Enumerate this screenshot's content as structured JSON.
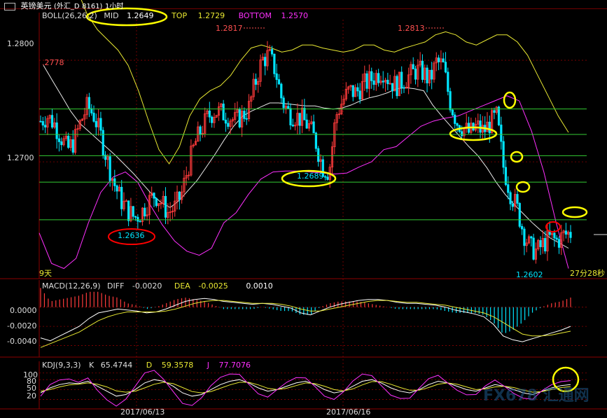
{
  "title_bar": {
    "symbol": "英镑美元",
    "market": "(外汇_D",
    "code": "8161)",
    "period": "1小时"
  },
  "colors": {
    "background": "#000000",
    "up": "#ff3b3b",
    "down": "#00e5ff",
    "mid": "#e8e8e8",
    "top": "#e8e832",
    "bottom": "#ff30ff",
    "grid": "#8b0000",
    "hline": "#33cc33",
    "highlight_yellow": "#ffff00",
    "highlight_red": "#ff0000"
  },
  "boll": {
    "label": "BOLL(26,26,2)",
    "mid_label": "MID",
    "mid_value": "1.2649",
    "top_label": "TOP",
    "top_value": "1.2729",
    "bottom_label": "BOTTOM",
    "bottom_value": "1.2570"
  },
  "macd": {
    "label": "MACD(12,26,9)",
    "diff_label": "DIFF",
    "diff_value": "-0.0020",
    "dea_label": "DEA",
    "dea_value": "-0.0025",
    "macd_value": "0.0010"
  },
  "kdj": {
    "label": "KDJ(9,3,3)",
    "k_label": "K",
    "k_value": "65.4744",
    "d_label": "D",
    "d_value": "59.3578",
    "j_label": "J",
    "j_value": "77.7076"
  },
  "annotations": {
    "left_price": ".2778",
    "high1": "1.2817",
    "high2": "1.2813",
    "low_a": "1.2636",
    "low_b": "1.2689",
    "low_c": "1.2602",
    "left_bottom_text": "9天",
    "countdown": "27分28秒"
  },
  "watermark": "FX678 汇通网",
  "chart_data": [
    {
      "type": "candlestick",
      "panel": "price",
      "title": "",
      "y_tick_labels": [
        "1.2800",
        "1.2700"
      ],
      "ylim": [
        1.2585,
        1.284
      ],
      "grid": true,
      "horizontal_levels": [
        1.2752,
        1.2727,
        1.2706,
        1.268,
        1.2643
      ],
      "approx_close_path": [
        1.274,
        1.2745,
        1.2738,
        1.2725,
        1.2712,
        1.272,
        1.274,
        1.2755,
        1.2745,
        1.2725,
        1.27,
        1.2678,
        1.2662,
        1.2652,
        1.2645,
        1.265,
        1.266,
        1.2668,
        1.266,
        1.265,
        1.2655,
        1.2668,
        1.2695,
        1.2718,
        1.2732,
        1.2745,
        1.275,
        1.2748,
        1.2745,
        1.274,
        1.2745,
        1.2752,
        1.2778,
        1.28,
        1.2805,
        1.279,
        1.276,
        1.2748,
        1.2745,
        1.2742,
        1.2735,
        1.272,
        1.2695,
        1.269,
        1.2745,
        1.276,
        1.277,
        1.2768,
        1.2775,
        1.278,
        1.2785,
        1.279,
        1.278,
        1.2775,
        1.278,
        1.2785,
        1.279,
        1.2788,
        1.278,
        1.2798,
        1.2795,
        1.276,
        1.274,
        1.2733,
        1.2728,
        1.2735,
        1.273,
        1.2738,
        1.2745,
        1.2695,
        1.267,
        1.2655,
        1.263,
        1.2615,
        1.2612,
        1.262,
        1.2625,
        1.2622,
        1.2628,
        1.263
      ],
      "mid_band": [
        1.2795,
        1.278,
        1.2765,
        1.275,
        1.2738,
        1.273,
        1.2722,
        1.2714,
        1.2706,
        1.2697,
        1.2688,
        1.2678,
        1.2668,
        1.266,
        1.2655,
        1.2662,
        1.2672,
        1.2682,
        1.2695,
        1.2708,
        1.2722,
        1.2735,
        1.2745,
        1.275,
        1.2754,
        1.2758,
        1.2758,
        1.2757,
        1.2756,
        1.2755,
        1.2755,
        1.2753,
        1.2752,
        1.2753,
        1.2756,
        1.276,
        1.2763,
        1.2765,
        1.2768,
        1.2772,
        1.2773,
        1.2772,
        1.277,
        1.2756,
        1.2745,
        1.2735,
        1.2725,
        1.2715,
        1.2706,
        1.2694,
        1.268,
        1.2668,
        1.2658,
        1.2649,
        1.264,
        1.2632,
        1.2625,
        1.262,
        1.2615
      ],
      "top_band": [
        1.287,
        1.2845,
        1.283,
        1.282,
        1.281,
        1.2795,
        1.277,
        1.274,
        1.2712,
        1.2698,
        1.2715,
        1.2745,
        1.2762,
        1.277,
        1.2775,
        1.2785,
        1.28,
        1.2812,
        1.2815,
        1.2812,
        1.2808,
        1.281,
        1.2815,
        1.2815,
        1.2812,
        1.281,
        1.2808,
        1.281,
        1.2815,
        1.2815,
        1.281,
        1.2808,
        1.2812,
        1.2815,
        1.2818,
        1.2825,
        1.2828,
        1.2825,
        1.2818,
        1.2815,
        1.282,
        1.2825,
        1.2825,
        1.2818,
        1.2805,
        1.2785,
        1.2765,
        1.2745,
        1.2729
      ],
      "bottom_band": [
        1.263,
        1.26,
        1.2595,
        1.2605,
        1.264,
        1.267,
        1.2685,
        1.269,
        1.268,
        1.2658,
        1.2638,
        1.2622,
        1.2612,
        1.2608,
        1.2615,
        1.264,
        1.265,
        1.2668,
        1.2683,
        1.269,
        1.2691,
        1.2691,
        1.269,
        1.2689,
        1.2688,
        1.2689,
        1.2695,
        1.27,
        1.2712,
        1.2715,
        1.2725,
        1.2735,
        1.274,
        1.2743,
        1.2745,
        1.275,
        1.2755,
        1.276,
        1.2765,
        1.276,
        1.273,
        1.269,
        1.264,
        1.2595
      ]
    },
    {
      "type": "bar",
      "panel": "macd",
      "title": "",
      "y_tick_labels": [
        "0.0000",
        "-0.0020",
        "-0.0040"
      ],
      "ylim": [
        -0.0052,
        0.0018
      ],
      "grid": true,
      "diff_line": [
        -0.0032,
        -0.0035,
        -0.003,
        -0.0025,
        -0.002,
        -0.0012,
        -0.0006,
        -0.0004,
        -0.0002,
        -0.0003,
        -0.0004,
        -0.0006,
        -0.0005,
        -0.0002,
        0.0002,
        0.0006,
        0.0008,
        0.0009,
        0.0008,
        0.0006,
        0.0005,
        0.0004,
        0.0003,
        0.0004,
        0.0003,
        0.0001,
        -0.0001,
        -0.0006,
        -0.0008,
        -0.0004,
        0.0,
        0.0003,
        0.0005,
        0.0007,
        0.0008,
        0.0008,
        0.0007,
        0.0005,
        0.0004,
        0.0004,
        0.0003,
        0.0002,
        0.0,
        -0.0003,
        -0.0005,
        -0.0007,
        -0.001,
        -0.0018,
        -0.003,
        -0.0034,
        -0.0036,
        -0.0033,
        -0.003,
        -0.0027,
        -0.0024,
        -0.002
      ],
      "dea_line": [
        -0.0042,
        -0.0038,
        -0.0034,
        -0.003,
        -0.0026,
        -0.002,
        -0.0014,
        -0.001,
        -0.0007,
        -0.0005,
        -0.0005,
        -0.0005,
        -0.0005,
        -0.0004,
        -0.0002,
        0.0001,
        0.0004,
        0.0006,
        0.0007,
        0.0007,
        0.0006,
        0.0005,
        0.0004,
        0.0004,
        0.0004,
        0.0003,
        0.0001,
        -0.0002,
        -0.0004,
        -0.0004,
        -0.0002,
        0.0,
        0.0002,
        0.0004,
        0.0006,
        0.0007,
        0.0007,
        0.0006,
        0.0005,
        0.0005,
        0.0004,
        0.0003,
        0.0002,
        0.0,
        -0.0002,
        -0.0004,
        -0.0006,
        -0.001,
        -0.0016,
        -0.0022,
        -0.0028,
        -0.003,
        -0.003,
        -0.0029,
        -0.0027,
        -0.0025
      ]
    },
    {
      "type": "line",
      "panel": "kdj",
      "title": "",
      "y_tick_labels": [
        "100",
        "80",
        "50",
        "20"
      ],
      "ylim": [
        0,
        110
      ],
      "grid": true,
      "k_line": [
        40,
        55,
        65,
        70,
        68,
        75,
        60,
        45,
        30,
        35,
        50,
        70,
        80,
        75,
        60,
        40,
        30,
        35,
        50,
        65,
        75,
        80,
        70,
        55,
        45,
        50,
        60,
        70,
        75,
        65,
        50,
        40,
        45,
        60,
        75,
        80,
        70,
        55,
        45,
        40,
        50,
        65,
        75,
        70,
        60,
        50,
        45,
        55,
        65,
        60,
        50,
        40,
        35,
        45,
        55,
        62,
        65
      ],
      "d_line": [
        45,
        50,
        58,
        64,
        66,
        70,
        66,
        58,
        46,
        42,
        45,
        55,
        66,
        72,
        68,
        56,
        44,
        40,
        44,
        54,
        64,
        72,
        72,
        64,
        54,
        50,
        54,
        62,
        70,
        68,
        60,
        50,
        46,
        52,
        64,
        74,
        74,
        66,
        56,
        48,
        48,
        56,
        66,
        70,
        66,
        58,
        50,
        52,
        58,
        60,
        56,
        48,
        42,
        44,
        50,
        56,
        59
      ]
    }
  ],
  "x_axis": {
    "tick_labels": [
      "2017/06/13",
      "2017/06/16"
    ]
  }
}
